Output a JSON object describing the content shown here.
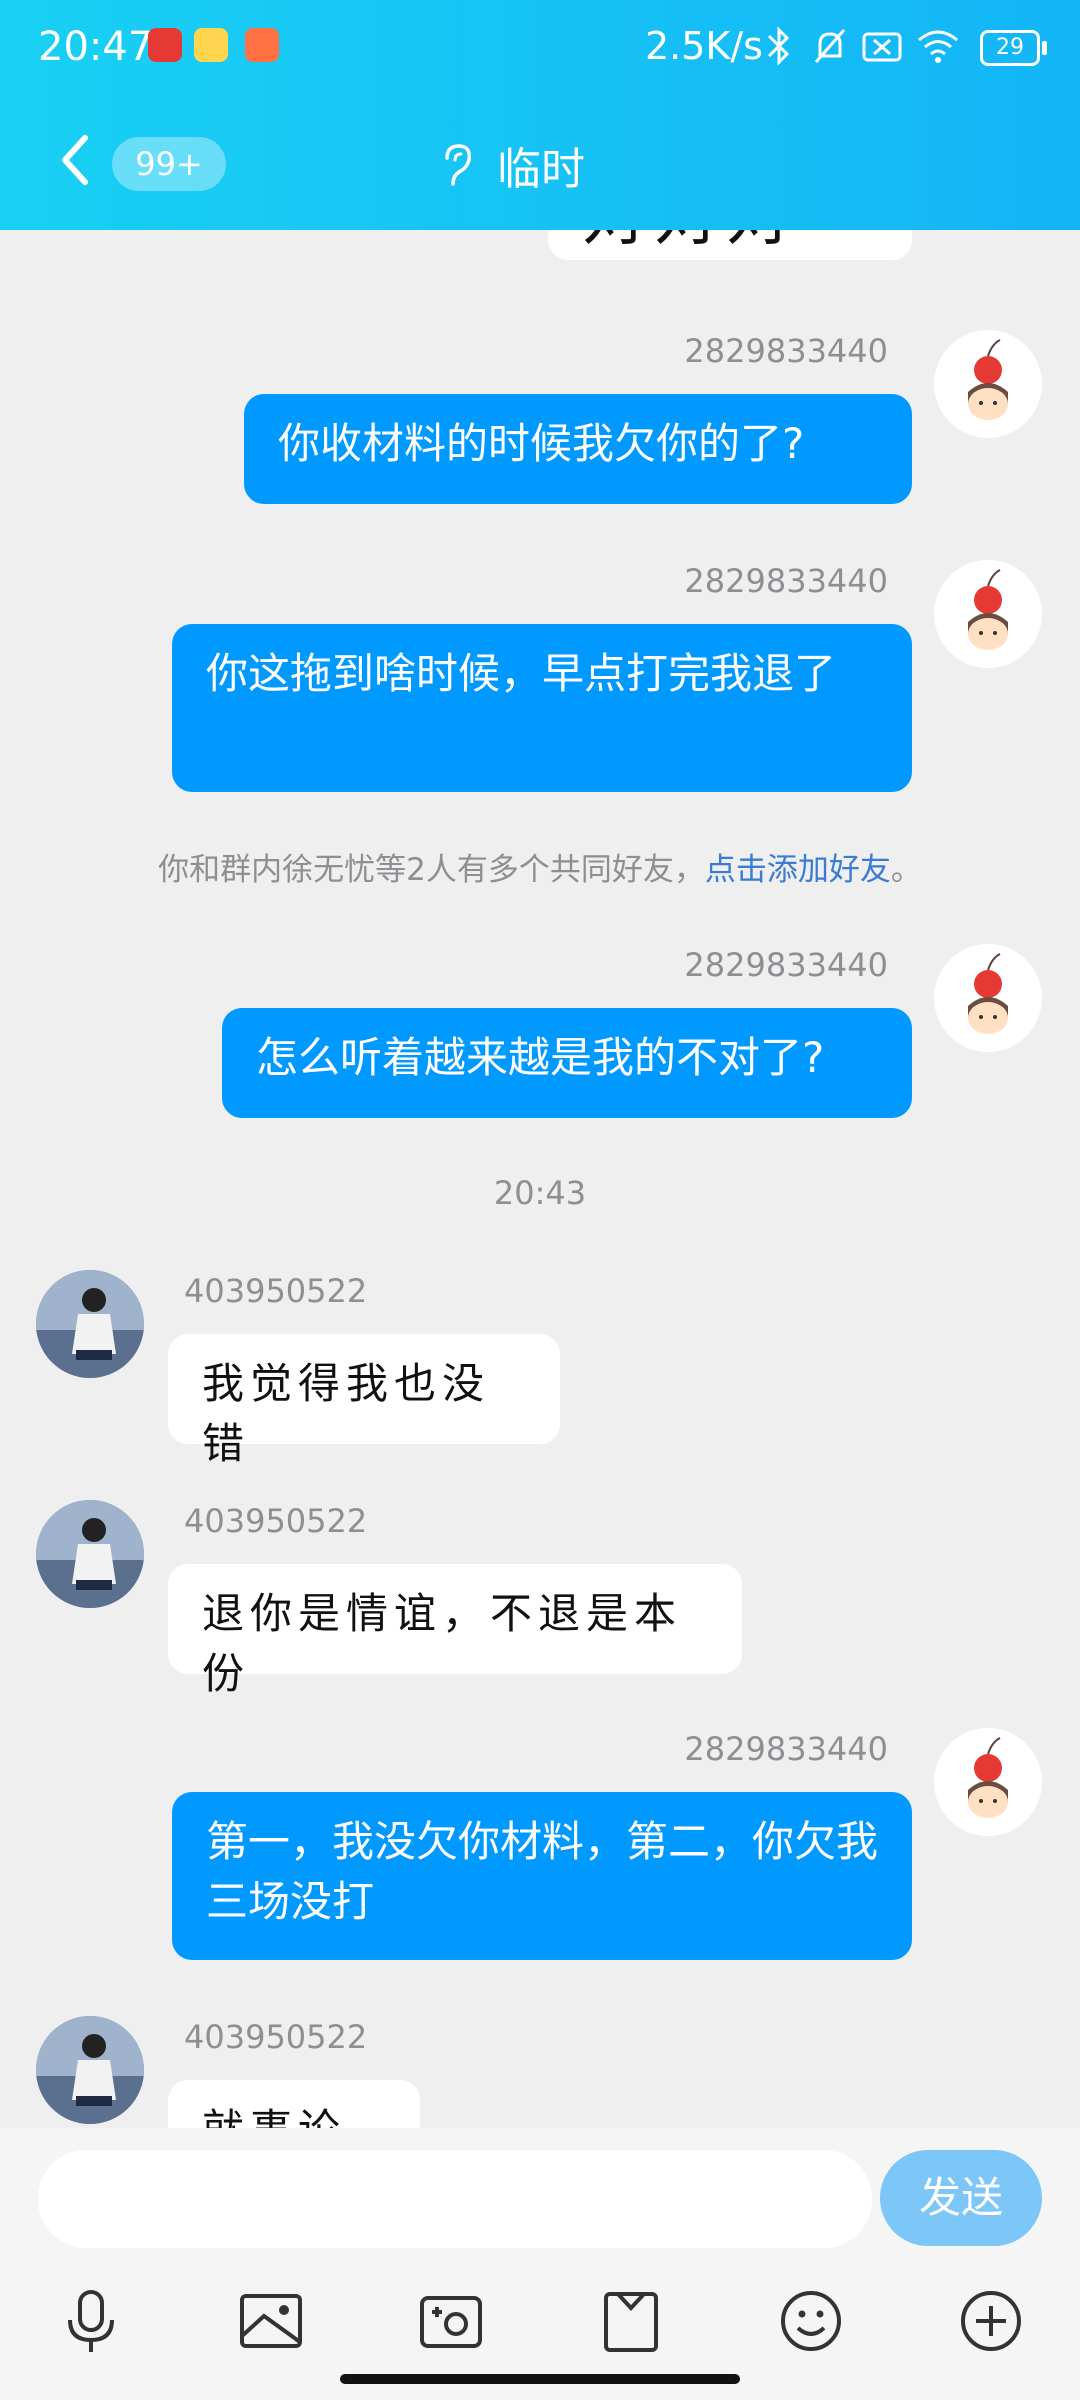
{
  "status": {
    "time": "20:47",
    "speed": "2.5K/s",
    "battery": "29"
  },
  "header": {
    "back_badge": "99+",
    "title": "临时"
  },
  "messages": {
    "m0_sender": "2829833440",
    "m0_text": "你收材料的时候我欠你的了?",
    "m1_sender": "2829833440",
    "m1_text": "你这拖到啥时候，早点打完我退了",
    "system_note_prefix": "你和群内徐无忧等2人有多个共同好友，",
    "system_note_link": "点击添加好友",
    "system_note_suffix": "。",
    "m2_sender": "2829833440",
    "m2_text": "怎么听着越来越是我的不对了?",
    "time_divider": "20:43",
    "m3_sender": "403950522",
    "m3_text": "我觉得我也没错",
    "m4_sender": "403950522",
    "m4_text": "退你是情谊，不退是本份",
    "m5_sender": "2829833440",
    "m5_text": "第一，我没欠你材料，第二，你欠我三场没打",
    "m6_sender": "403950522",
    "m6_text": "就事论事",
    "top_partial_text": "对对对"
  },
  "input": {
    "placeholder": "",
    "send_label": "发送"
  },
  "toolbar": {
    "icons": [
      "mic-icon",
      "image-icon",
      "camera-icon",
      "file-icon",
      "emoji-icon",
      "plus-icon"
    ]
  },
  "colors": {
    "header_start": "#19d0f3",
    "header_end": "#13b5f7",
    "outgoing_bubble": "#0099ff",
    "send_button": "#7dc6f8",
    "link": "#3a7bd5"
  }
}
